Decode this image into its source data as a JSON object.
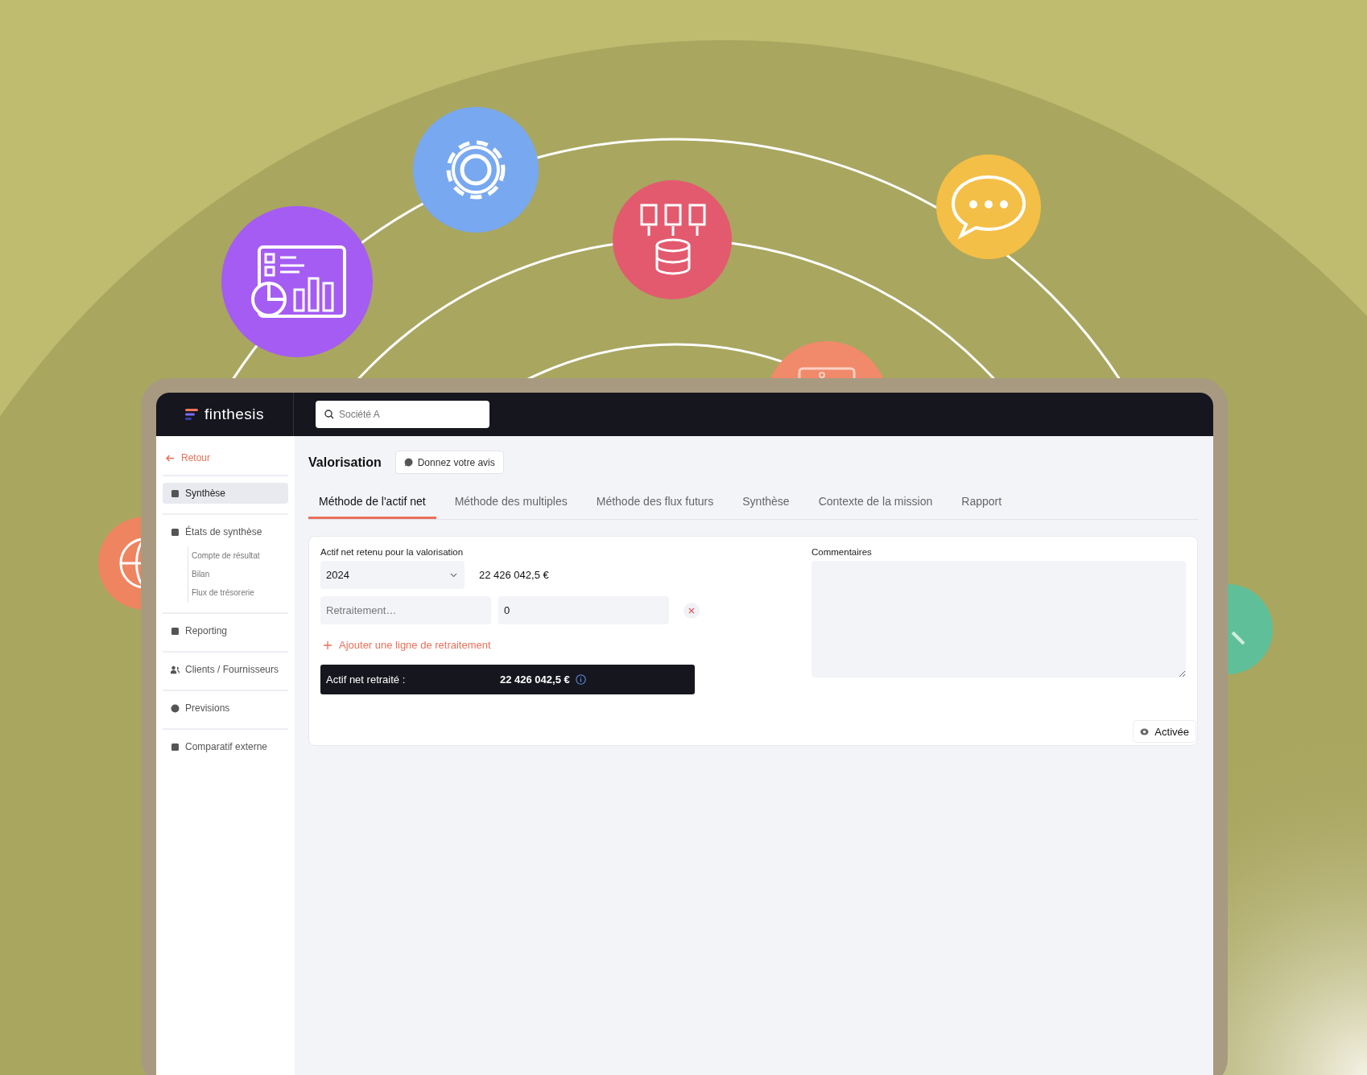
{
  "app": {
    "brand": "finthesis",
    "search": {
      "placeholder": "Société A"
    }
  },
  "sidebar": {
    "back": "Retour",
    "items": [
      {
        "label": "Synthèse",
        "selected": true
      },
      {
        "label": "États de synthèse",
        "selected": false,
        "children": [
          {
            "label": "Compte de résultat",
            "selected": false
          },
          {
            "label": "Bilan",
            "selected": false
          },
          {
            "label": "Flux de trésorerie",
            "selected": false
          }
        ]
      },
      {
        "label": "Reporting",
        "selected": false
      },
      {
        "label": "Clients / Fournisseurs",
        "selected": false
      },
      {
        "label": "Previsions",
        "selected": false
      },
      {
        "label": "Comparatif externe",
        "selected": false
      }
    ]
  },
  "page": {
    "title": "Valorisation",
    "feedback_button": "Donnez votre avis"
  },
  "tabs": [
    {
      "label": "Méthode de l'actif net",
      "selected": true
    },
    {
      "label": "Méthode des multiples",
      "selected": false
    },
    {
      "label": "Méthode des flux futurs",
      "selected": false
    },
    {
      "label": "Synthèse",
      "selected": false
    },
    {
      "label": "Contexte de la mission",
      "selected": false
    },
    {
      "label": "Rapport",
      "selected": false
    }
  ],
  "form": {
    "label": "Actif net retenu pour la valorisation",
    "year_select": {
      "value": "2024"
    },
    "amount": "22 426 042,5 €",
    "adjustments": [
      {
        "label_placeholder": "Retraitement…",
        "value": "0"
      }
    ],
    "add_link": "Ajouter une ligne de retraitement",
    "total": {
      "label": "Actif net retraité :",
      "value": "22 426 042,5 €"
    }
  },
  "comments": {
    "label": "Commentaires"
  },
  "status_button": "Activée"
}
